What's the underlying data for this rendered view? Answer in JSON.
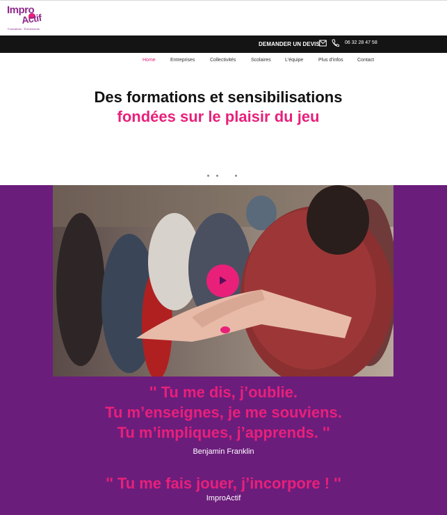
{
  "logo": {
    "word1": "Impro",
    "word2": "Actif",
    "tagline": "Formations · Événements"
  },
  "topbar": {
    "quote_label": "DEMANDER UN DEVIS",
    "mail_icon": "mail-icon",
    "phone_icon": "phone-icon",
    "phone_number": "06 32 28 47 58"
  },
  "nav": {
    "items": [
      {
        "label": "Home",
        "active": true
      },
      {
        "label": "Entreprises",
        "active": false
      },
      {
        "label": "Collectivités",
        "active": false
      },
      {
        "label": "Scolaires",
        "active": false
      },
      {
        "label": "L'équipe",
        "active": false
      },
      {
        "label": "Plus d'infos",
        "active": false
      },
      {
        "label": "Contact",
        "active": false
      }
    ]
  },
  "hero": {
    "line1": "Des formations et sensibilisations",
    "line2": "fondées sur le plaisir du jeu"
  },
  "video": {
    "play_icon": "play-icon"
  },
  "quotes": {
    "q1_line1": "'' Tu me dis, j’oublie.",
    "q1_line2": "Tu m’enseignes, je me souviens.",
    "q1_line3": "Tu m’impliques, j’apprends. ''",
    "q1_author": "Benjamin Franklin",
    "q2_line1": "'' Tu me fais jouer, j’incorpore ! ''",
    "q2_author": "ImproActif"
  },
  "colors": {
    "brand_purple": "#6b1d7c",
    "brand_pink": "#e8207a",
    "topbar_black": "#141414"
  }
}
